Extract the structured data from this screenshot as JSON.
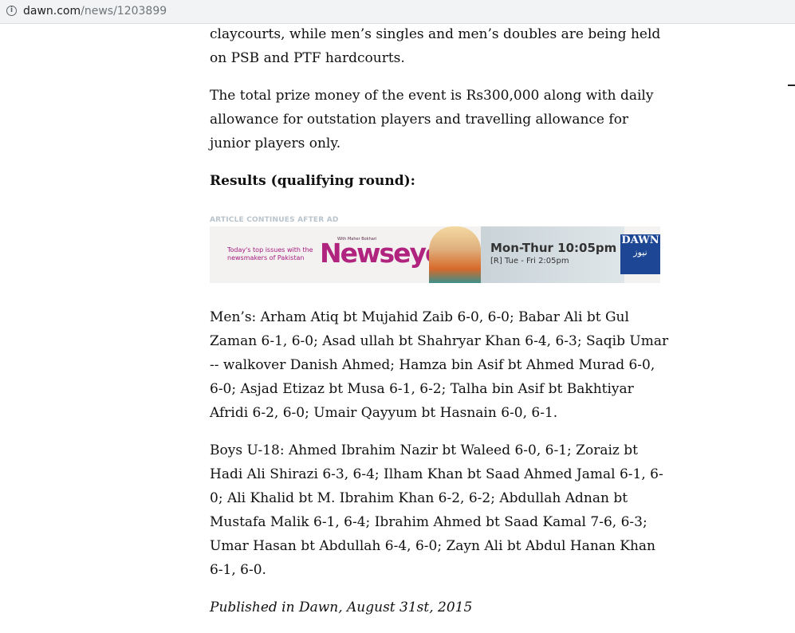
{
  "browser": {
    "url_domain": "dawn.com",
    "url_path": "/news/1203899",
    "info_icon_glyph": "i"
  },
  "article": {
    "para_courts": "claycourts, while men’s singles and men’s doubles are being held on PSB and PTF hardcourts.",
    "para_prize": "The total prize money of the event is Rs300,000 along with daily allowance for outstation players and travelling allowance for junior players only.",
    "results_heading": "Results (qualifying round):",
    "ad_label": "ARTICLE CONTINUES AFTER AD",
    "para_mens": "Men’s: Arham Atiq bt Mujahid Zaib 6-0, 6-0; Babar Ali bt Gul Zaman 6-1, 6-0; Asad ullah bt Shahryar Khan 6-4, 6-3; Saqib Umar -- walkover Danish Ahmed; Hamza bin Asif bt Ahmed Murad 6-0, 6-0; Asjad Etizaz bt Musa 6-1, 6-2; Talha bin Asif bt Bakhtiyar Afridi 6-2, 6-0; Umair Qayyum bt Hasnain 6-0, 6-1.",
    "para_boys": "Boys U-18: Ahmed Ibrahim Nazir bt Waleed 6-0, 6-1; Zoraiz bt Hadi Ali Shirazi 6-3, 6-4; Ilham Khan bt Saad Ahmed Jamal 6-1, 6-0; Ali Khalid bt M. Ibrahim Khan 6-2, 6-2; Abdullah Adnan bt Mustafa Malik 6-1, 6-4; Ibrahim Ahmed bt Saad Kamal 7-6, 6-3; Umar Hasan bt Abdullah 6-4, 6-0; Zayn Ali bt Abdul Hanan Khan 6-1, 6-0.",
    "published": "Published in Dawn, August 31st, 2015"
  },
  "ad": {
    "tagline": "Today's top issues with the newsmakers of Pakistan",
    "with_line": "With Maher Bokhari",
    "logo": "Newseye",
    "schedule_main": "Mon-Thur 10:05pm",
    "schedule_repeat": "[R] Tue - Fri 2:05pm",
    "dawn_logo": "DAWN",
    "dawn_urdu": "نیوز"
  }
}
